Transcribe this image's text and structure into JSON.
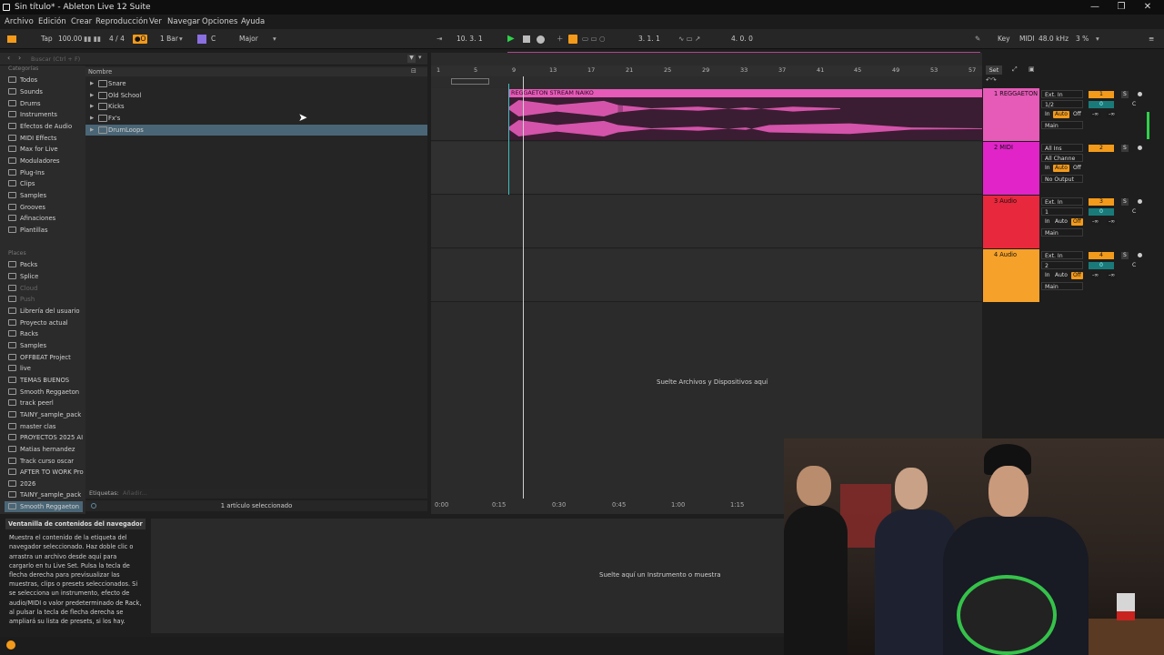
{
  "window": {
    "title": "Sin título* - Ableton Live 12 Suite",
    "minimize": "—",
    "restore": "❐",
    "close": "✕"
  },
  "menu": [
    "Archivo",
    "Edición",
    "Crear",
    "Reproducción",
    "Ver",
    "Navegar",
    "Opciones",
    "Ayuda"
  ],
  "control": {
    "tap": "Tap",
    "tempo": "100.00",
    "signature": "4 / 4",
    "metronome": "●O",
    "quantize": "1 Bar",
    "key": "C",
    "scale": "Major",
    "position": "10.  3.  1",
    "loop_start": "3.  1.  1",
    "loop_length": "4.  0.  0",
    "key_label": "Key",
    "midi_label": "MIDI",
    "sample_rate": "48.0 kHz",
    "cpu": "3 %"
  },
  "browser": {
    "search_placeholder": "Buscar (Ctrl + F)",
    "categories_header": "Categorías",
    "categories": [
      "Todos",
      "Sounds",
      "Drums",
      "Instruments",
      "Efectos de Audio",
      "MIDI Effects",
      "Max for Live",
      "Moduladores",
      "Plug-Ins",
      "Clips",
      "Samples",
      "Grooves",
      "Afinaciones",
      "Plantillas"
    ],
    "places_header": "Places",
    "places": [
      "Packs",
      "Splice",
      "Cloud",
      "Push",
      "Librería del usuario",
      "Proyecto actual",
      "Racks",
      "Samples",
      "OFFBEAT Project",
      "live",
      "TEMAS BUENOS",
      "Smooth Reggaeton",
      "track peerl",
      "TAINY_sample_pack",
      "master clas",
      "PROYECTOS 2025 AI",
      "Matias hernandez",
      "Track curso oscar",
      "AFTER TO WORK Pro",
      "2026",
      "TAINY_sample_pack",
      "Smooth Reggaeton"
    ],
    "column_header": "Nombre",
    "files": [
      "Snare",
      "Old School",
      "Kicks",
      "Fx's",
      "DrumLoops"
    ],
    "tags_label": "Etiquetas:",
    "tags_placeholder": "Añadir...",
    "status": "1 artículo seleccionado"
  },
  "ruler": {
    "bars": [
      "1",
      "5",
      "9",
      "13",
      "17",
      "21",
      "25",
      "29",
      "33",
      "37",
      "41",
      "45",
      "49",
      "53",
      "57"
    ],
    "set": "Set"
  },
  "tracks": [
    {
      "name": "1 REGGAETON",
      "color": "#e65ab8",
      "input": "Ext. In",
      "channel": "1/2",
      "output": "Main",
      "number": "1",
      "vol": "0",
      "pan": "C",
      "clip": "REGGAETON STREAM NAIKO"
    },
    {
      "name": "2 MIDI",
      "color": "#e024c8",
      "input": "All Ins",
      "channel": "All Channe",
      "output": "No Output",
      "number": "2"
    },
    {
      "name": "3 Audio",
      "color": "#e8283c",
      "input": "Ext. In",
      "channel": "1",
      "output": "Main",
      "number": "3",
      "vol": "0",
      "pan": "C"
    },
    {
      "name": "4 Audio",
      "color": "#f5a12a",
      "input": "Ext. In",
      "channel": "2",
      "output": "Main",
      "number": "4",
      "vol": "0",
      "pan": "C"
    }
  ],
  "monitor": {
    "in": "In",
    "auto": "Auto",
    "off": "Off",
    "solo": "S",
    "inf": "-∞"
  },
  "drop_files": "Suelte Archivos y Dispositivos aquí",
  "timeline": [
    "0:00",
    "0:15",
    "0:30",
    "0:45",
    "1:00",
    "1:15"
  ],
  "info": {
    "title": "Ventanilla de contenidos del navegador",
    "body": "Muestra el contenido de la etiqueta del navegador seleccionado. Haz doble clic o arrastra un archivo desde aquí para cargarlo en tu Live Set. Pulsa la tecla de flecha derecha para previsualizar las muestras, clips o presets seleccionados. Si se selecciona un instrumento, efecto de audio/MIDI o valor predeterminado de Rack, al pulsar la tecla de flecha derecha se ampliará su lista de presets, si los hay."
  },
  "detail_drop": "Suelte aquí un Instrumento o muestra",
  "colors": {
    "accent": "#f39a1b",
    "play": "#2fd14a",
    "selection": "#4a6676"
  }
}
